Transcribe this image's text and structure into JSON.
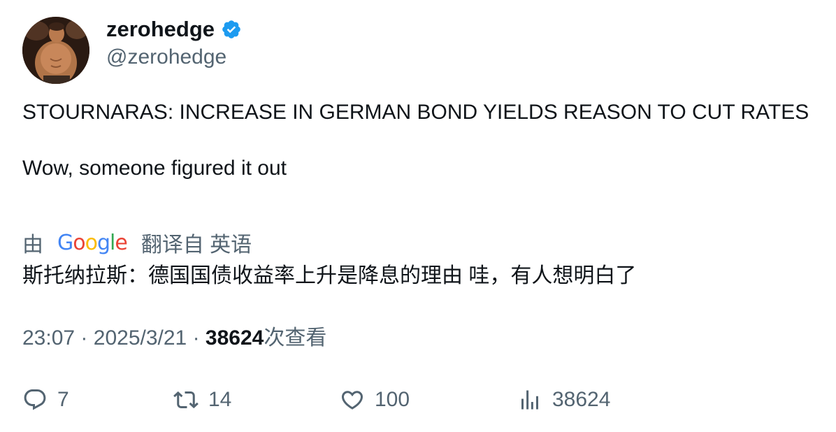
{
  "author": {
    "name": "zerohedge",
    "handle": "@zerohedge",
    "verified_icon": "verified-badge-icon",
    "verified_color": "#1d9bf0"
  },
  "tweet": {
    "text": "STOURNARAS: INCREASE IN GERMAN BOND YIELDS REASON TO CUT RATES\n\nWow, someone figured it out"
  },
  "translation": {
    "by": "由",
    "provider_letters": [
      "G",
      "o",
      "o",
      "g",
      "l",
      "e"
    ],
    "translated_from": "翻译自 英语",
    "text": "斯托纳拉斯：德国国债收益率上升是降息的理由 哇，有人想明白了"
  },
  "meta": {
    "time": "23:07",
    "separator": "·",
    "date": "2025/3/21",
    "views_count": "38624",
    "views_label": "次查看"
  },
  "actions": {
    "reply_count": "7",
    "retweet_count": "14",
    "like_count": "100",
    "views_count": "38624"
  },
  "colors": {
    "text_primary": "#0f1419",
    "text_secondary": "#536471",
    "accent": "#1d9bf0"
  }
}
